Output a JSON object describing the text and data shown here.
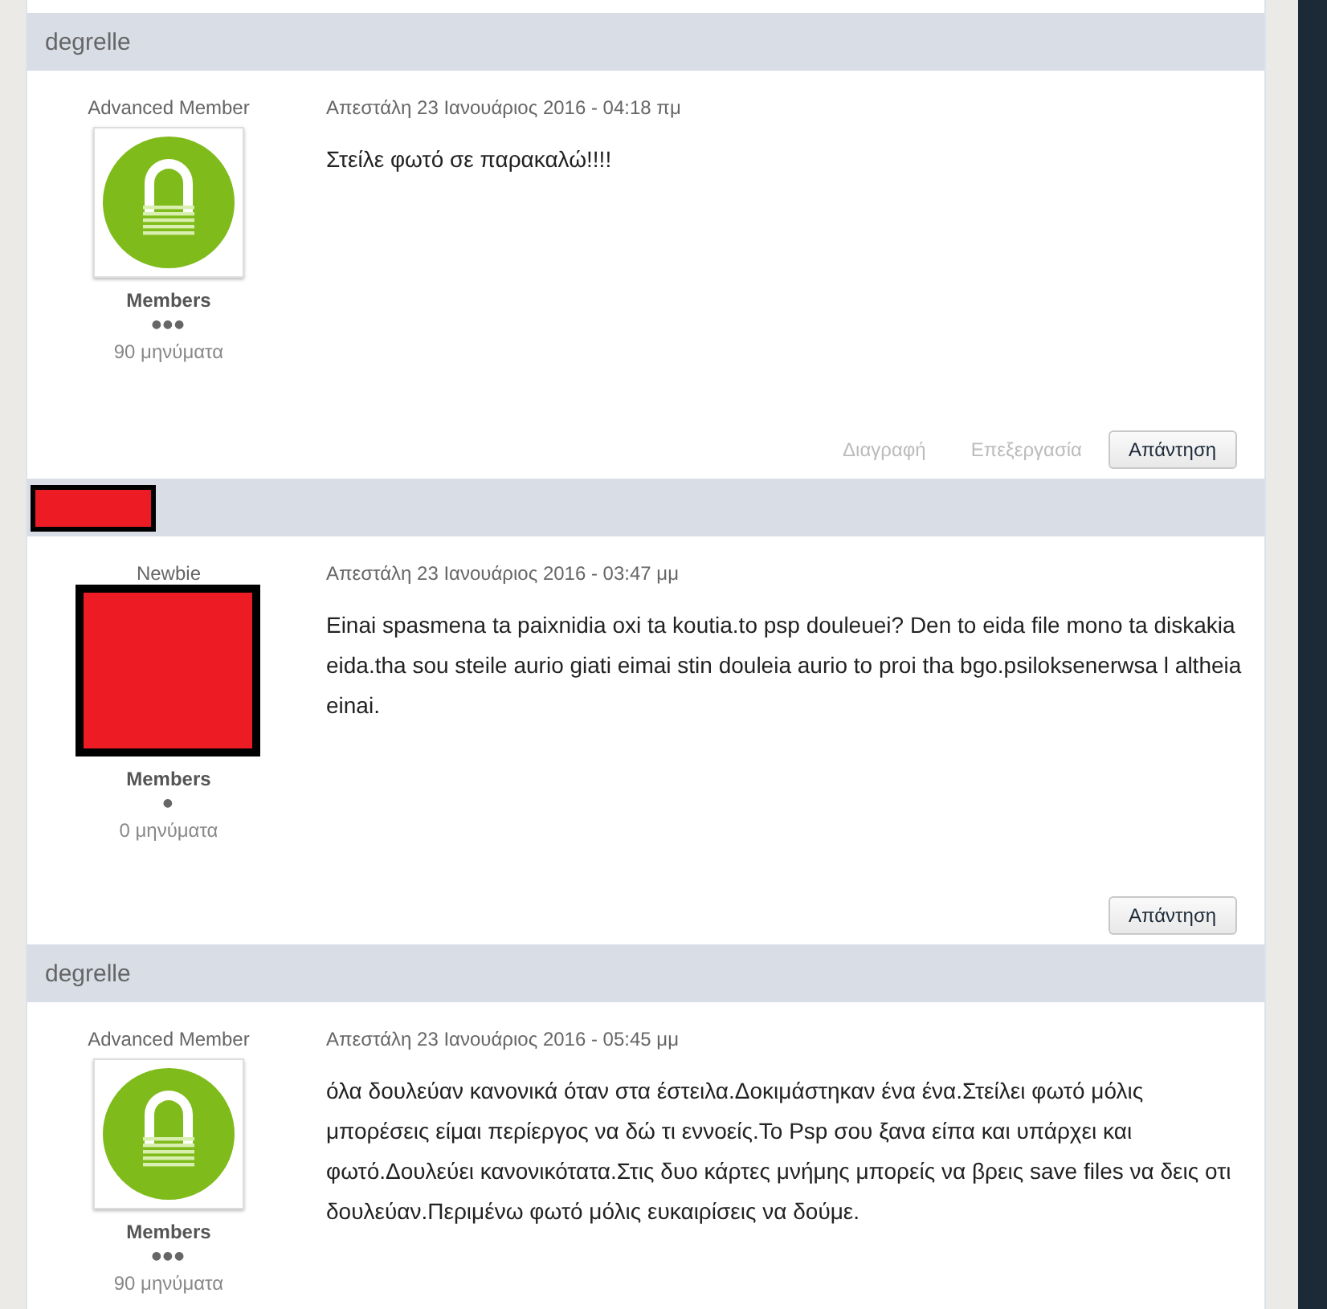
{
  "posts": [
    {
      "author": {
        "kind": "name",
        "name": "degrelle"
      },
      "rank": "Advanced Member",
      "avatar": {
        "kind": "logo"
      },
      "group": "Members",
      "rank_pips": "●●●",
      "post_count": "90 μηνύματα",
      "date": "Απεστάλη 23 Ιανουάριος 2016 - 04:18 πμ",
      "body": "Στείλε φωτό σε παρακαλώ!!!!",
      "actions": [
        {
          "kind": "link",
          "label": "Διαγραφή",
          "disabled": true
        },
        {
          "kind": "link",
          "label": "Επεξεργασία",
          "disabled": true
        },
        {
          "kind": "button",
          "label": "Απάντηση",
          "disabled": false
        }
      ]
    },
    {
      "author": {
        "kind": "redacted"
      },
      "rank": "Newbie",
      "avatar": {
        "kind": "redacted"
      },
      "group": "Members",
      "rank_pips": "●",
      "post_count": "0 μηνύματα",
      "date": "Απεστάλη 23 Ιανουάριος 2016 - 03:47 μμ",
      "body": "Einai spasmena ta paixnidia oxi ta koutia.to psp douleuei? Den to eida file mono ta diskakia eida.tha sou steile aurio giati eimai stin douleia aurio to proi tha bgo.psiloksenerwsa l altheia einai.",
      "actions": [
        {
          "kind": "button",
          "label": "Απάντηση",
          "disabled": false
        }
      ]
    },
    {
      "author": {
        "kind": "name",
        "name": "degrelle"
      },
      "rank": "Advanced Member",
      "avatar": {
        "kind": "logo"
      },
      "group": "Members",
      "rank_pips": "●●●",
      "post_count": "90 μηνύματα",
      "date": "Απεστάλη 23 Ιανουάριος 2016 - 05:45 μμ",
      "body": "όλα δουλεύαν κανονικά όταν στα έστειλα.Δοκιμάστηκαν ένα ένα.Στείλει φωτό μόλις μπορέσεις είμαι περίεργος να δώ τι εννοείς.Το Psp σου ξανα είπα και υπάρχει και φωτό.Δουλεύει κανονικότατα.Στις δυο κάρτες μνήμης μπορείς να βρεις save files να δεις οτι δουλεύαν.Περιμένω φωτό μόλις ευκαιρίσεις να δούμε."
    }
  ]
}
